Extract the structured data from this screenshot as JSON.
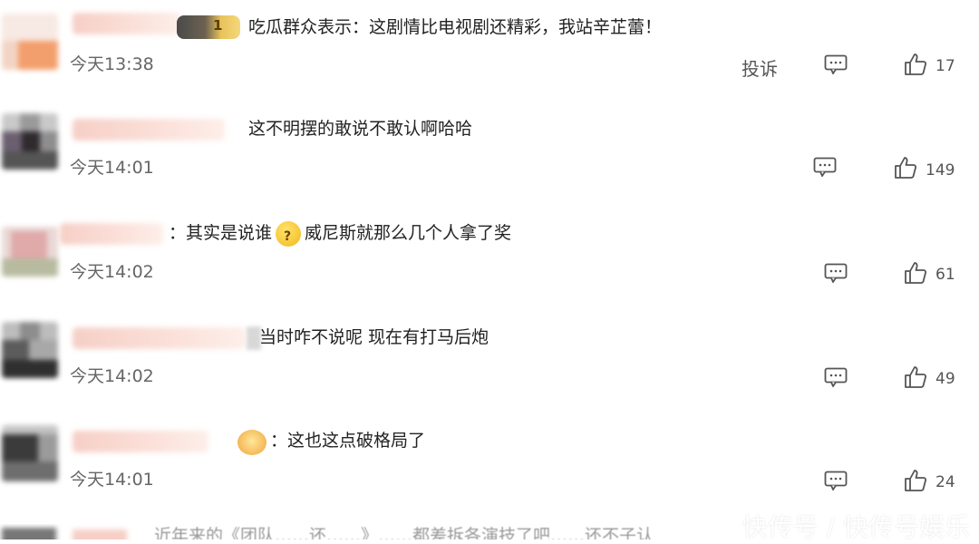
{
  "report_label": "投诉",
  "comments": [
    {
      "text": "吃瓜群众表示：这剧情比电视剧还精彩，我站辛芷蕾！",
      "time": "今天13:38",
      "likes": "17",
      "badge_text": "1"
    },
    {
      "text": "这不明摆的敢说不敢认啊哈哈",
      "time": "今天14:01",
      "likes": "149"
    },
    {
      "text_before": "：其实是说谁",
      "text_after": "威尼斯就那么几个人拿了奖",
      "time": "今天14:02",
      "likes": "61"
    },
    {
      "text": "当时咋不说呢 现在有打马后炮",
      "time": "今天14:02",
      "likes": "49"
    },
    {
      "text": "：这也这点破格局了",
      "time": "今天14:01",
      "likes": "24"
    }
  ],
  "partial_row_text": "近年来的《团队……还……》……都差拆各演技了吧……还不子认",
  "watermark": "快传号 / 快传号娱乐",
  "icons": {
    "reply": "comment-icon",
    "like": "thumbs-up-icon",
    "emoji": "thinking-emoji-icon"
  }
}
